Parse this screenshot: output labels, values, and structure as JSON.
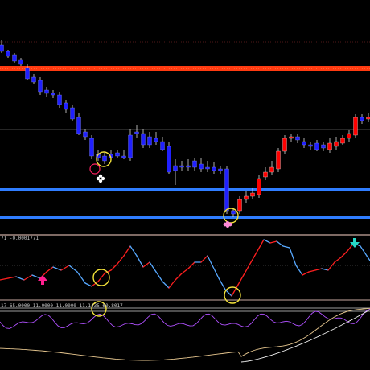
{
  "indicator1": {
    "label": "71 -0.0001771"
  },
  "indicator2": {
    "label": "17 65.0000 11.0000 11.0000 11.1435 60.8017"
  },
  "colors": {
    "background": "#000000",
    "bull_body": "#ff0000",
    "bear_body": "#2020ff",
    "wick": "#d8d8d8",
    "resistance_band": "#ff3a10",
    "support_line": "#2f7dff",
    "osc_up": "#ff2020",
    "osc_down": "#57a8ff",
    "marker_circle": "#f3e23a",
    "arrow_up": "#ff1f8f",
    "arrow_down": "#27d9c8",
    "separator": "#c9a9a0"
  },
  "icons": {
    "buy_arrow": "arrow-up-icon",
    "sell_arrow": "arrow-down-icon",
    "signal_flower": "flower-icon",
    "signal_circle": "circle-icon"
  }
}
